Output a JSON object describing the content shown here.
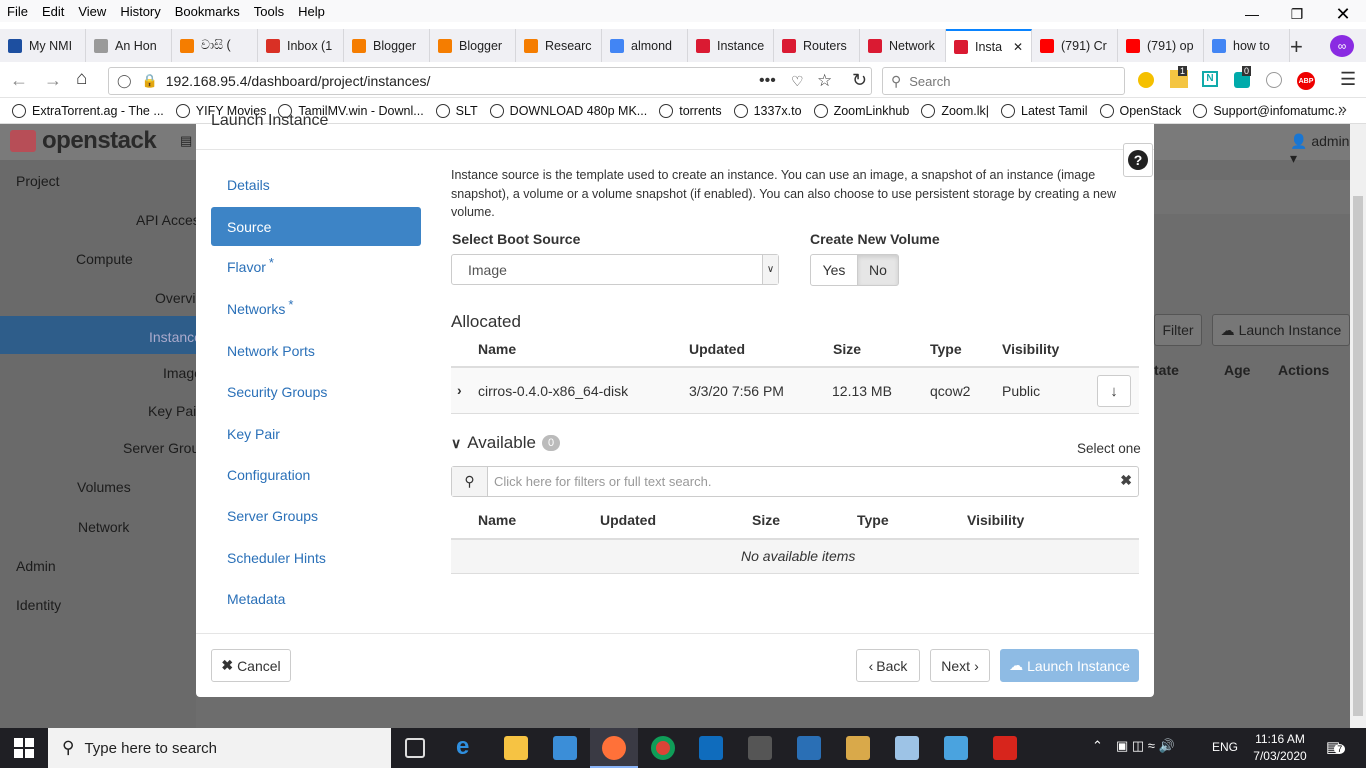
{
  "menubar": {
    "items": [
      "File",
      "Edit",
      "View",
      "History",
      "Bookmarks",
      "Tools",
      "Help"
    ]
  },
  "tabs": [
    {
      "label": "My NMI",
      "color": "#1d4fa0",
      "icon": "nmi-icon"
    },
    {
      "label": "An Hon",
      "color": "#9a9a9a",
      "icon": "page-icon"
    },
    {
      "label": "වාසි (",
      "color": "#f57d00",
      "icon": "blogger-icon"
    },
    {
      "label": "Inbox (1",
      "color": "#d93025",
      "icon": "gmail-icon"
    },
    {
      "label": "Blogger",
      "color": "#f57d00",
      "icon": "blogger-icon"
    },
    {
      "label": "Blogger",
      "color": "#f57d00",
      "icon": "blogger-icon"
    },
    {
      "label": "Researc",
      "color": "#f57d00",
      "icon": "blogger-icon"
    },
    {
      "label": "almond",
      "color": "#4285f4",
      "icon": "google-icon"
    },
    {
      "label": "Instance",
      "color": "#da1a32",
      "icon": "openstack-icon"
    },
    {
      "label": "Routers",
      "color": "#da1a32",
      "icon": "openstack-icon"
    },
    {
      "label": "Network",
      "color": "#da1a32",
      "icon": "openstack-icon"
    },
    {
      "label": "Insta",
      "color": "#da1a32",
      "icon": "openstack-icon",
      "active": true
    },
    {
      "label": "(791) Cr",
      "color": "#ff0000",
      "icon": "youtube-icon"
    },
    {
      "label": "(791) op",
      "color": "#ff0000",
      "icon": "youtube-icon"
    },
    {
      "label": "how to",
      "color": "#4285f4",
      "icon": "google-icon"
    }
  ],
  "nav": {
    "url": "192.168.95.4/dashboard/project/instances/",
    "search_placeholder": "Search",
    "ext_badge_1": "1",
    "ext_badge_2": "0",
    "abp": "ABP"
  },
  "bookmarks": [
    "ExtraTorrent.ag - The ...",
    "YIFY Movies",
    "TamilMV.win - Downl...",
    "SLT",
    "DOWNLOAD 480p MK...",
    "torrents",
    "1337x.to",
    "ZoomLinkhub",
    "Zoom.lk|",
    "Latest Tamil",
    "OpenStack",
    "Support@infomatumc..."
  ],
  "openstack": {
    "logo": "openstack",
    "user": "admin",
    "sidebar": [
      {
        "label": "Project",
        "indent": 0
      },
      {
        "label": "API Acces",
        "indent": 2
      },
      {
        "label": "Compute",
        "indent": 1
      },
      {
        "label": "Overvie",
        "indent": 3
      },
      {
        "label": "Instance",
        "indent": 3,
        "active": true
      },
      {
        "label": "Image",
        "indent": 3
      },
      {
        "label": "Key Pai",
        "indent": 3
      },
      {
        "label": "Server Group",
        "indent": 2
      },
      {
        "label": "Volumes",
        "indent": 1
      },
      {
        "label": "Network",
        "indent": 1
      },
      {
        "label": "Admin",
        "indent": 0
      },
      {
        "label": "Identity",
        "indent": 0
      }
    ],
    "filter_button": "Filter",
    "launch_button": "Launch Instance",
    "bg_cols": [
      "tate",
      "Age",
      "Actions"
    ]
  },
  "modal": {
    "title": "Launch Instance",
    "nav": [
      {
        "label": "Details",
        "required": false
      },
      {
        "label": "Source",
        "required": false,
        "active": true
      },
      {
        "label": "Flavor",
        "required": true
      },
      {
        "label": "Networks",
        "required": true
      },
      {
        "label": "Network Ports",
        "required": false
      },
      {
        "label": "Security Groups",
        "required": false
      },
      {
        "label": "Key Pair",
        "required": false
      },
      {
        "label": "Configuration",
        "required": false
      },
      {
        "label": "Server Groups",
        "required": false
      },
      {
        "label": "Scheduler Hints",
        "required": false
      },
      {
        "label": "Metadata",
        "required": false
      }
    ],
    "required_mark": "*",
    "description": "Instance source is the template used to create an instance. You can use an image, a snapshot of an instance (image snapshot), a volume or a volume snapshot (if enabled). You can also choose to use persistent storage by creating a new volume.",
    "boot_source_label": "Select Boot Source",
    "boot_source_value": "Image",
    "new_volume_label": "Create New Volume",
    "yes": "Yes",
    "no": "No",
    "allocated_title": "Allocated",
    "columns": [
      "Name",
      "Updated",
      "Size",
      "Type",
      "Visibility"
    ],
    "allocated_rows": [
      {
        "name": "cirros-0.4.0-x86_64-disk",
        "updated": "3/3/20 7:56 PM",
        "size": "12.13 MB",
        "type": "qcow2",
        "visibility": "Public"
      }
    ],
    "available_title": "Available",
    "available_count": "0",
    "select_one": "Select one",
    "filter_placeholder": "Click here for filters or full text search.",
    "no_items": "No available items",
    "cancel": "Cancel",
    "back": "Back",
    "next": "Next",
    "launch": "Launch Instance"
  },
  "taskbar": {
    "search": "Type here to search",
    "lang": "ENG",
    "time": "11:16 AM",
    "date": "7/03/2020",
    "notif": "7"
  }
}
